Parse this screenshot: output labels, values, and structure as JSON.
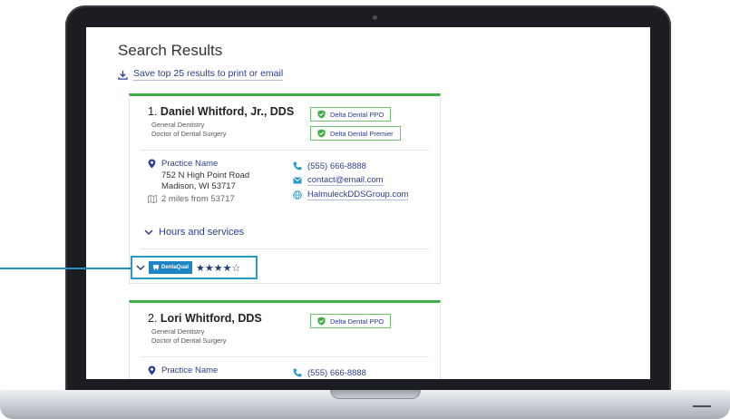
{
  "screen": {
    "title": "Search Results",
    "save_link": "Save top 25 results to print or email"
  },
  "results": [
    {
      "rank": "1.",
      "name": "Daniel Whitford, Jr., DDS",
      "specialty": "General Dentistry",
      "degree": "Doctor of Dental Surgery",
      "plans": [
        "Delta Dental PPO",
        "Delta Dental Premier"
      ],
      "practice": "Practice Name",
      "address_line1": "752 N High Point Road",
      "address_line2": "Madison, WI 53717",
      "distance": "2 miles from 53717",
      "phone": "(555) 666-8888",
      "email": "contact@email.com",
      "website": "HalmuleckDDSGroup.com",
      "hours_label": "Hours and services",
      "rating_brand": "DentaQual",
      "rating_stars": 4,
      "rating_max": 5
    },
    {
      "rank": "2.",
      "name": "Lori Whitford, DDS",
      "specialty": "General Dentistry",
      "degree": "Doctor of Dental Surgery",
      "plans": [
        "Delta Dental PPO"
      ],
      "practice": "Practice Name",
      "phone": "(555) 666-8888"
    }
  ],
  "colors": {
    "accent_green": "#3fae49",
    "link_blue": "#2d3e8c",
    "callout_blue": "#2a9bc8"
  }
}
